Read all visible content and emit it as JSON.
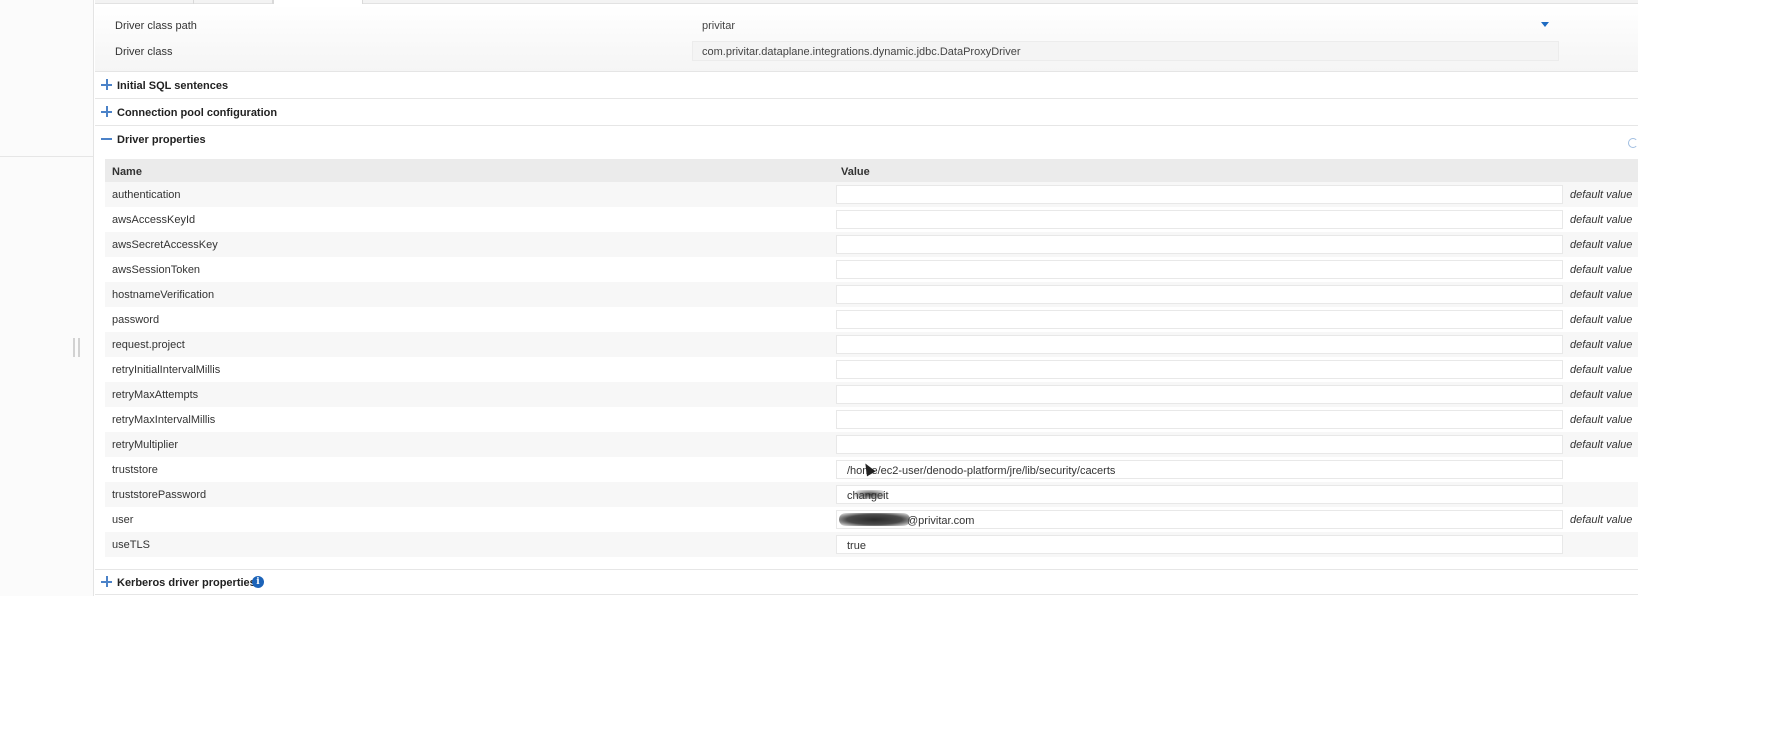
{
  "driver_config": {
    "class_path_label": "Driver class path",
    "class_path_value": "privitar",
    "class_label": "Driver class",
    "class_value": "com.privitar.dataplane.integrations.dynamic.jdbc.DataProxyDriver"
  },
  "sections": {
    "initial_sql": "Initial SQL sentences",
    "connection_pool": "Connection pool configuration",
    "driver_properties": "Driver properties",
    "kerberos": "Kerberos driver properties"
  },
  "icons": {
    "expand": "plus-icon",
    "collapse": "minus-icon",
    "info": "info-icon",
    "refresh": "refresh-icon",
    "dropdown": "chevron-down-icon"
  },
  "info_glyph": "i",
  "table": {
    "columns": [
      "Name",
      "Value"
    ],
    "rows": [
      {
        "name": "authentication",
        "value": "",
        "default": "default value"
      },
      {
        "name": "awsAccessKeyId",
        "value": "",
        "default": "default value"
      },
      {
        "name": "awsSecretAccessKey",
        "value": "",
        "default": "default value"
      },
      {
        "name": "awsSessionToken",
        "value": "",
        "default": "default value"
      },
      {
        "name": "hostnameVerification",
        "value": "",
        "default": "default value"
      },
      {
        "name": "password",
        "value": "",
        "default": "default value"
      },
      {
        "name": "request.project",
        "value": "",
        "default": "default value"
      },
      {
        "name": "retryInitialIntervalMillis",
        "value": "",
        "default": "default value"
      },
      {
        "name": "retryMaxAttempts",
        "value": "",
        "default": "default value"
      },
      {
        "name": "retryMaxIntervalMillis",
        "value": "",
        "default": "default value"
      },
      {
        "name": "retryMultiplier",
        "value": "",
        "default": "default value"
      },
      {
        "name": "truststore",
        "value": "/home/ec2-user/denodo-platform/jre/lib/security/cacerts",
        "default": ""
      },
      {
        "name": "truststorePassword",
        "value": "changeit",
        "default": ""
      },
      {
        "name": "user",
        "value": "@privitar.com",
        "default": "default value"
      },
      {
        "name": "useTLS",
        "value": "true",
        "default": ""
      }
    ]
  },
  "colors": {
    "accent": "#1e6bc2",
    "toggle": "#4b82c8",
    "header_bg": "#ebebeb"
  }
}
